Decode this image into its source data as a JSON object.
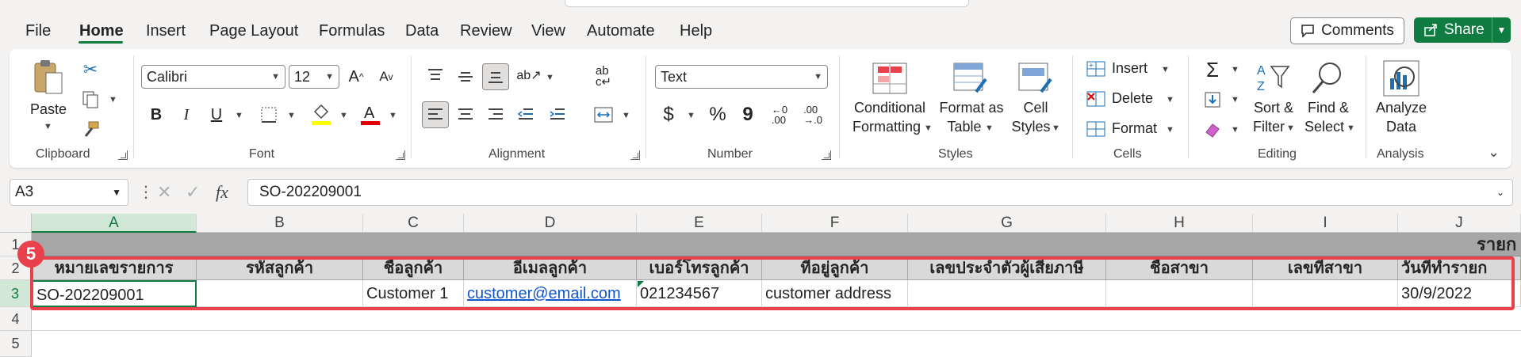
{
  "tabs": [
    "File",
    "Home",
    "Insert",
    "Page Layout",
    "Formulas",
    "Data",
    "Review",
    "View",
    "Automate",
    "Help"
  ],
  "header_buttons": {
    "comments": "Comments",
    "share": "Share"
  },
  "clipboard": {
    "paste": "Paste",
    "label": "Clipboard"
  },
  "font": {
    "name": "Calibri",
    "size": "12",
    "label": "Font",
    "bold": "B",
    "italic": "I",
    "underline": "U"
  },
  "alignment": {
    "label": "Alignment"
  },
  "number": {
    "format": "Text",
    "label": "Number",
    "currency": "$",
    "percent": "%",
    "comma": "9",
    "inc_dec": "←0\n.00",
    "dec_dec": ".00\n→.0"
  },
  "styles": {
    "conditional_1": "Conditional",
    "conditional_2": "Formatting",
    "format_table_1": "Format as",
    "format_table_2": "Table",
    "cell_styles_1": "Cell",
    "cell_styles_2": "Styles",
    "label": "Styles"
  },
  "cells": {
    "insert": "Insert",
    "delete": "Delete",
    "format": "Format",
    "label": "Cells"
  },
  "editing": {
    "sort_1": "Sort &",
    "sort_2": "Filter",
    "find_1": "Find &",
    "find_2": "Select",
    "label": "Editing"
  },
  "analysis": {
    "analyze_1": "Analyze",
    "analyze_2": "Data",
    "label": "Analysis"
  },
  "formula_bar": {
    "name_box": "A3",
    "fx": "fx",
    "value": "SO-202209001"
  },
  "grid": {
    "columns": [
      "A",
      "B",
      "C",
      "D",
      "E",
      "F",
      "G",
      "H",
      "I",
      "J"
    ],
    "rows": [
      "1",
      "2",
      "3",
      "4",
      "5"
    ],
    "row1_partial": "รายก",
    "headers": [
      "หมายเลขรายการ",
      "รหัสลูกค้า",
      "ชื่อลูกค้า",
      "อีเมลลูกค้า",
      "เบอร์โทรลูกค้า",
      "ที่อยู่ลูกค้า",
      "เลขประจำตัวผู้เสียภาษี",
      "ชื่อสาขา",
      "เลขที่สาขา",
      "วันที่ทำรายก"
    ],
    "row3": [
      "SO-202209001",
      "",
      "Customer 1",
      "customer@email.com",
      "021234567",
      "customer address",
      "",
      "",
      "",
      "30/9/2022"
    ]
  },
  "annotation": {
    "badge": "5",
    "color": "#e8414b"
  },
  "accent": "#107c41"
}
